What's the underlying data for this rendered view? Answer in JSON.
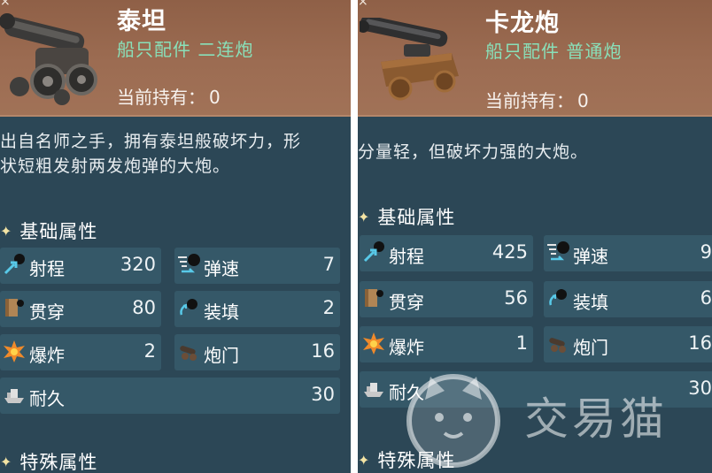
{
  "cards": [
    {
      "close": "×",
      "name": "泰坦",
      "type": "船只配件 二连炮",
      "owned_label": "当前持有：",
      "owned_value": "0",
      "description_line1": "出自名师之手，拥有泰坦般破坏力，形",
      "description_line2": "状短粗发射两发炮弹的大炮。",
      "basic_section": "基础属性",
      "special_section": "特殊属性",
      "stats": {
        "range": {
          "label": "射程",
          "value": "320"
        },
        "speed": {
          "label": "弹速",
          "value": "7"
        },
        "pierce": {
          "label": "贯穿",
          "value": "80"
        },
        "reload": {
          "label": "装填",
          "value": "2"
        },
        "explode": {
          "label": "爆炸",
          "value": "2"
        },
        "ports": {
          "label": "炮门",
          "value": "16"
        },
        "durability": {
          "label": "耐久",
          "value": "30"
        }
      }
    },
    {
      "close": "×",
      "name": "卡龙炮",
      "type": "船只配件 普通炮",
      "owned_label": "当前持有：",
      "owned_value": "0",
      "description_line1": "分量轻，但破坏力强的大炮。",
      "description_line2": "",
      "basic_section": "基础属性",
      "special_section": "特殊属性",
      "stats": {
        "range": {
          "label": "射程",
          "value": "425"
        },
        "speed": {
          "label": "弹速",
          "value": "9"
        },
        "pierce": {
          "label": "贯穿",
          "value": "56"
        },
        "reload": {
          "label": "装填",
          "value": "6"
        },
        "explode": {
          "label": "爆炸",
          "value": "1"
        },
        "ports": {
          "label": "炮门",
          "value": "16"
        },
        "durability": {
          "label": "耐久",
          "value": "30"
        }
      }
    }
  ],
  "watermark": {
    "text": "交易猫"
  },
  "colors": {
    "panel_bg": "#2c4756",
    "stat_bg": "#355868",
    "header_bg": "#9c6c52",
    "type_text": "#89e0b9"
  }
}
